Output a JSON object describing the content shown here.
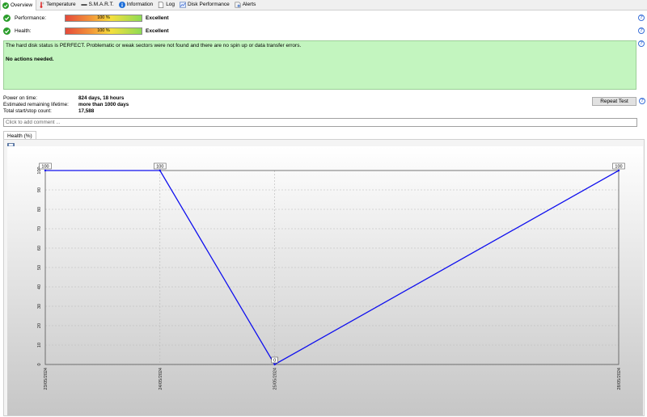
{
  "tabs": [
    {
      "label": "Overview",
      "icon": "check-circle-icon",
      "active": true
    },
    {
      "label": "Temperature",
      "icon": "thermometer-icon"
    },
    {
      "label": "S.M.A.R.T.",
      "icon": "dash-icon"
    },
    {
      "label": "Information",
      "icon": "info-icon"
    },
    {
      "label": "Log",
      "icon": "document-icon"
    },
    {
      "label": "Disk Performance",
      "icon": "performance-chart-icon"
    },
    {
      "label": "Alerts",
      "icon": "alerts-icon"
    }
  ],
  "status": {
    "performance": {
      "label": "Performance:",
      "bar_text": "100 %",
      "value": "Excellent",
      "percent": 100
    },
    "health": {
      "label": "Health:",
      "bar_text": "100 %",
      "value": "Excellent",
      "percent": 100
    }
  },
  "message": {
    "line1": "The hard disk status is PERFECT. Problematic or weak sectors were not found and there are no spin up or data transfer errors.",
    "line2": "No actions needed."
  },
  "info": {
    "power_on_label": "Power on time:",
    "power_on_value": "824 days, 18 hours",
    "lifetime_label": "Estimated remaining lifetime:",
    "lifetime_value": "more than 1000 days",
    "startstop_label": "Total start/stop count:",
    "startstop_value": "17,588"
  },
  "repeat_button": "Repeat Test",
  "comment_placeholder": "Click to add comment ...",
  "chart_tab": "Health (%)",
  "colors": {
    "line": "#1010ee",
    "ok_green": "#2a9d2a",
    "message_bg": "#c3f5bf"
  },
  "chart_data": {
    "type": "line",
    "x": [
      "23/05/2024",
      "24/05/2024",
      "25/05/2024",
      "28/05/2024"
    ],
    "series": [
      {
        "values": [
          100,
          100,
          0,
          100
        ]
      }
    ],
    "data_labels": [
      "100",
      "100",
      "0",
      "100"
    ],
    "y_ticks": [
      "0",
      "10",
      "20",
      "30",
      "40",
      "50",
      "60",
      "70",
      "80",
      "90",
      "100"
    ],
    "ylim": [
      0,
      100
    ],
    "grid": true
  }
}
